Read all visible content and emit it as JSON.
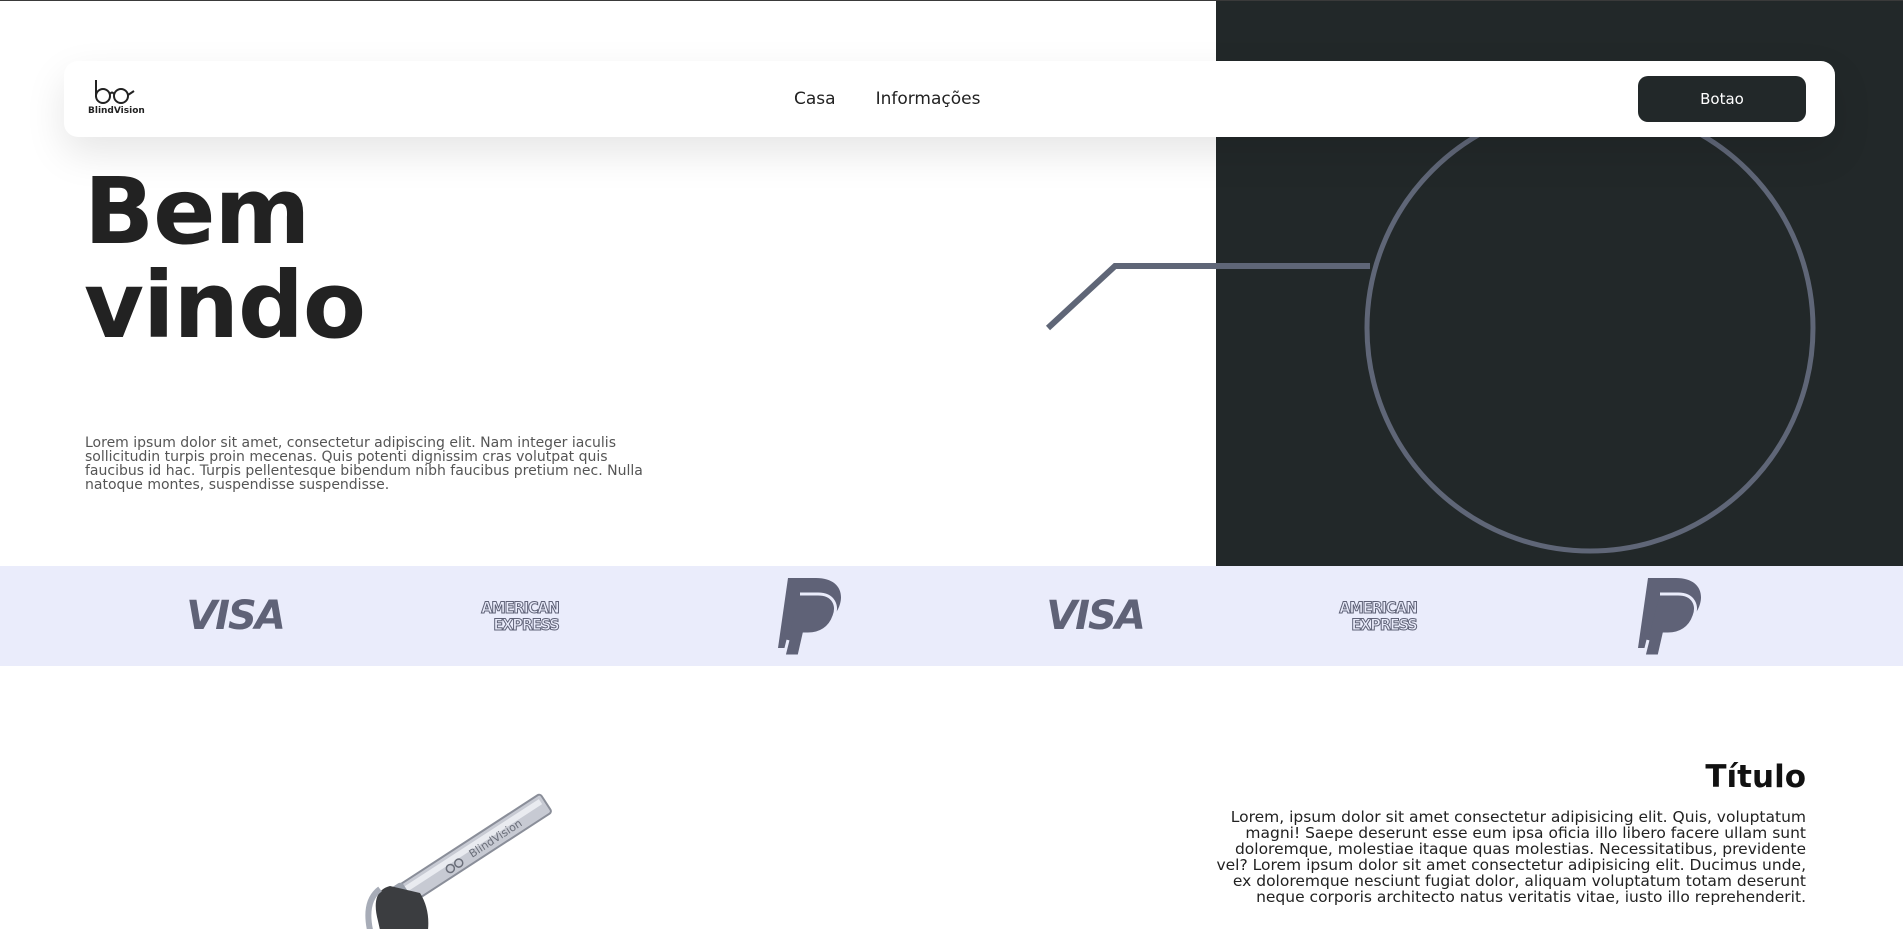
{
  "brand": {
    "logo_text": "BlindVision"
  },
  "nav": {
    "links": [
      "Casa",
      "Informações"
    ],
    "button_label": "Botao"
  },
  "hero": {
    "title_line1": "Bem",
    "title_line2": "vindo",
    "text": "Lorem ipsum dolor sit amet, consectetur adipiscing elit. Nam integer iaculis sollicitudin turpis proin mecenas. Quis potenti dignissim cras volutpat quis faucibus id hac. Turpis pellentesque bibendum nibh faucibus pretium nec. Nulla natoque montes, suspendisse suspendisse."
  },
  "payments": {
    "items": [
      {
        "type": "visa",
        "label": "VISA"
      },
      {
        "type": "amex",
        "line1": "AMERICAN",
        "line2": "EXPRESS"
      },
      {
        "type": "paypal",
        "icon": "paypal-icon"
      },
      {
        "type": "visa",
        "label": "VISA"
      },
      {
        "type": "amex",
        "line1": "AMERICAN",
        "line2": "EXPRESS"
      },
      {
        "type": "paypal",
        "icon": "paypal-icon"
      }
    ]
  },
  "feature": {
    "title": "Título",
    "text": "Lorem, ipsum dolor sit amet consectetur adipisicing elit. Quis, voluptatum magni! Saepe deserunt esse eum ipsa oficia illo libero facere ullam sunt doloremque, molestiae itaque quas molestias. Necessitatibus, previdente vel? Lorem ipsum dolor sit amet consectetur adipisicing elit. Ducimus unde, ex doloremque nesciunt fugiat dolor, aliquam voluptatum totam deserunt neque corporis architecto natus veritatis vitae, iusto illo reprehenderit.",
    "product_engraving": "BlindVision"
  },
  "colors": {
    "dark": "#222829",
    "accent_line": "#5f6677",
    "strip_bg": "#eaecfb",
    "logo_gray": "#5f6277"
  }
}
